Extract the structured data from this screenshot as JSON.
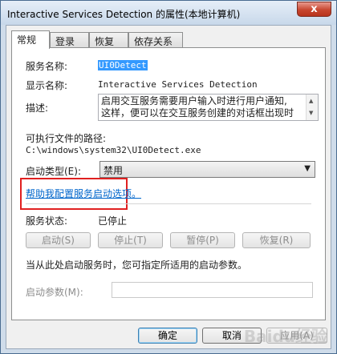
{
  "window": {
    "title": "Interactive Services Detection 的属性(本地计算机)",
    "close_glyph": "x"
  },
  "tabs": [
    {
      "label": "常规"
    },
    {
      "label": "登录"
    },
    {
      "label": "恢复"
    },
    {
      "label": "依存关系"
    }
  ],
  "general": {
    "service_name_label": "服务名称:",
    "service_name_value": "UI0Detect",
    "display_name_label": "显示名称:",
    "display_name_value": "Interactive Services Detection",
    "description_label": "描述:",
    "description_line1": "启用交互服务需要用户输入时进行用户通知,",
    "description_line2": "这样，便可以在交互服务创建的对话框出现时",
    "exe_path_label": "可执行文件的路径:",
    "exe_path_value": "C:\\windows\\system32\\UI0Detect.exe",
    "startup_type_label": "启动类型(E):",
    "startup_type_value": "禁用",
    "help_link": "帮助我配置服务启动选项。",
    "service_status_label": "服务状态:",
    "service_status_value": "已停止",
    "start_btn": "启动(S)",
    "stop_btn": "停止(T)",
    "pause_btn": "暂停(P)",
    "resume_btn": "恢复(R)",
    "hint": "当从此处启动服务时，您可指定所适用的启动参数。",
    "start_params_label": "启动参数(M):",
    "start_params_value": ""
  },
  "footer": {
    "ok_btn": "确定",
    "cancel_btn": "取消",
    "apply_btn": "应用(A)"
  },
  "watermark": "Baidu经验",
  "colors": {
    "highlight": "#e02020",
    "selection": "#3399ff",
    "link": "#0066cc"
  }
}
